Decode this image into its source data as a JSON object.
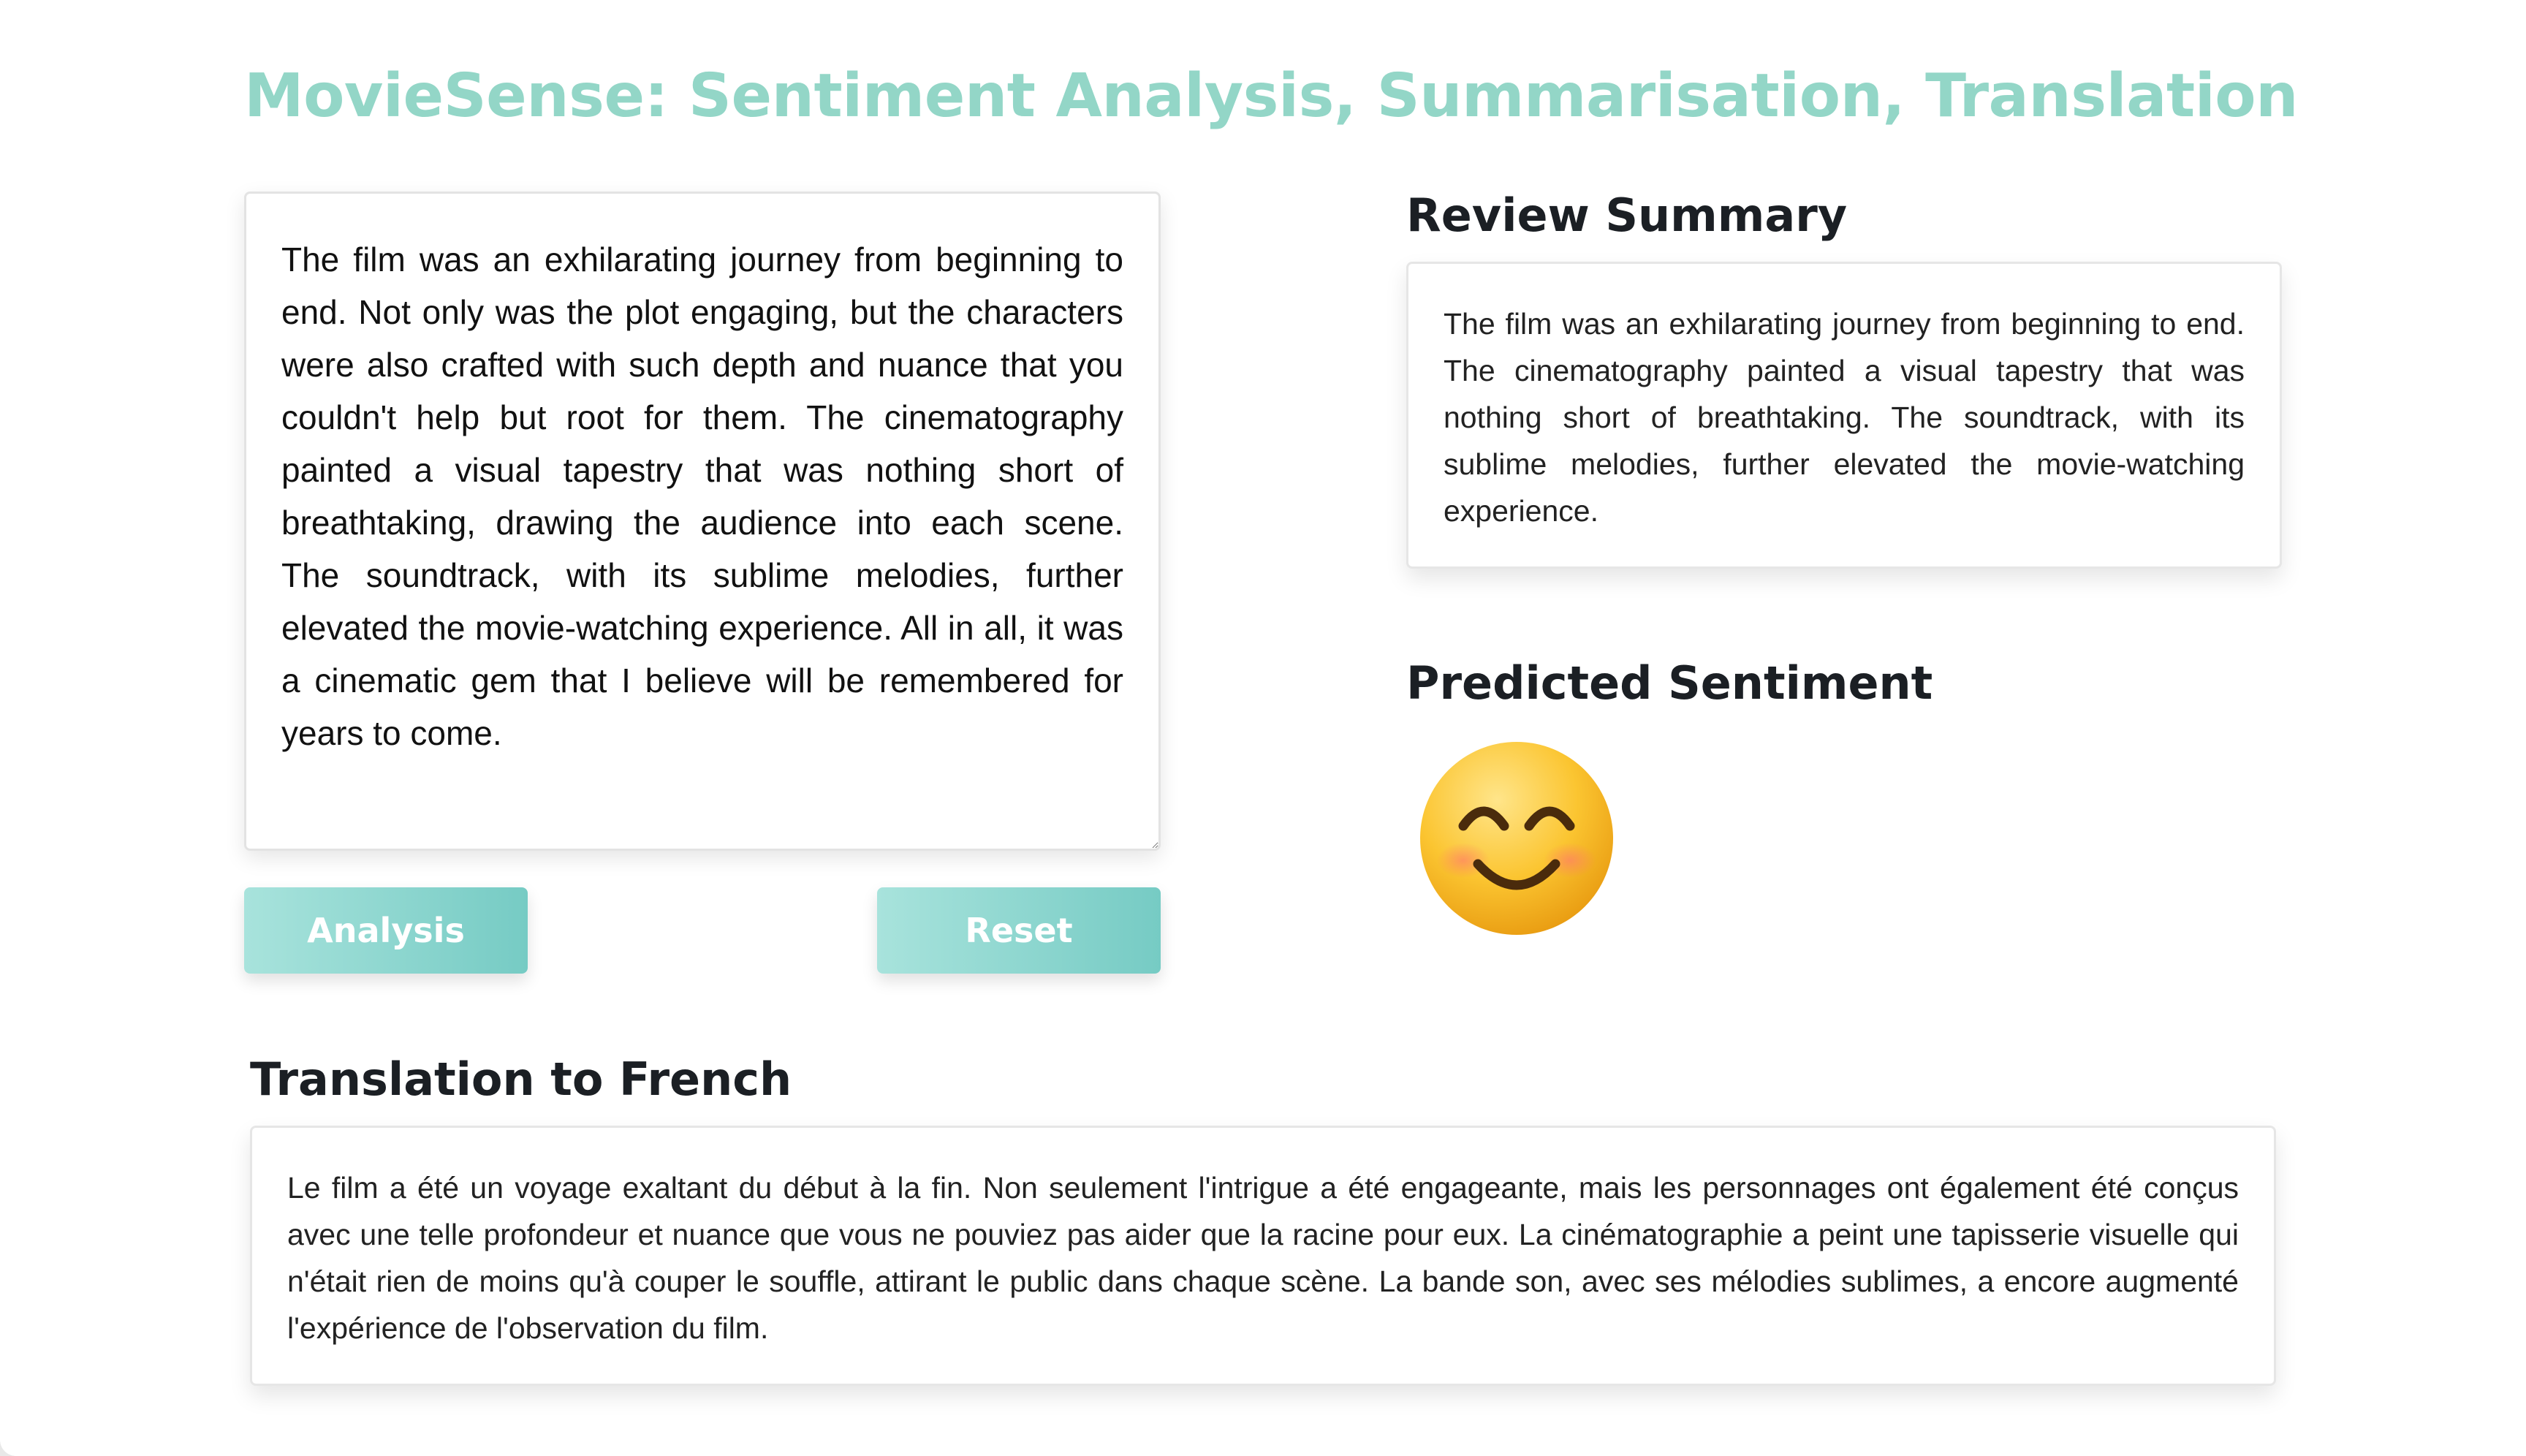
{
  "header": {
    "title": "MovieSense: Sentiment Analysis, Summarisation, Translation"
  },
  "review_input": {
    "value": "The film was an exhilarating journey from beginning to end. Not only was the plot engaging, but the characters were also crafted with such depth and nuance that you couldn't help but root for them. The cinematography painted a visual tapestry that was nothing short of breathtaking, drawing the audience into each scene. The soundtrack, with its sublime melodies, further elevated the movie-watching experience. All in all, it was a cinematic gem that I believe will be remembered for years to come."
  },
  "buttons": {
    "analysis_label": "Analysis",
    "reset_label": "Reset",
    "color_start": "#a8e3dc",
    "color_end": "#76cbc4"
  },
  "summary": {
    "heading": "Review Summary",
    "text": "The film was an exhilarating journey from beginning to end. The cinematography painted a visual tapestry that was nothing short of breathtaking. The soundtrack, with its sublime melodies, further elevated the movie-watching experience."
  },
  "sentiment": {
    "heading": "Predicted Sentiment",
    "icon": "smiling-face-icon"
  },
  "translation": {
    "heading": "Translation to French",
    "text": "Le film a été un voyage exaltant du début à la fin. Non seulement l'intrigue a été engageante, mais les personnages ont également été conçus avec une telle profondeur et nuance que vous ne pouviez pas aider que la racine pour eux. La cinématographie a peint une tapisserie visuelle qui n'était rien de moins qu'à couper le souffle, attirant le public dans chaque scène. La bande son, avec ses mélodies sublimes, a encore augmenté l'expérience de l'observation du film."
  },
  "theme": {
    "accent": "#93d6c7"
  }
}
